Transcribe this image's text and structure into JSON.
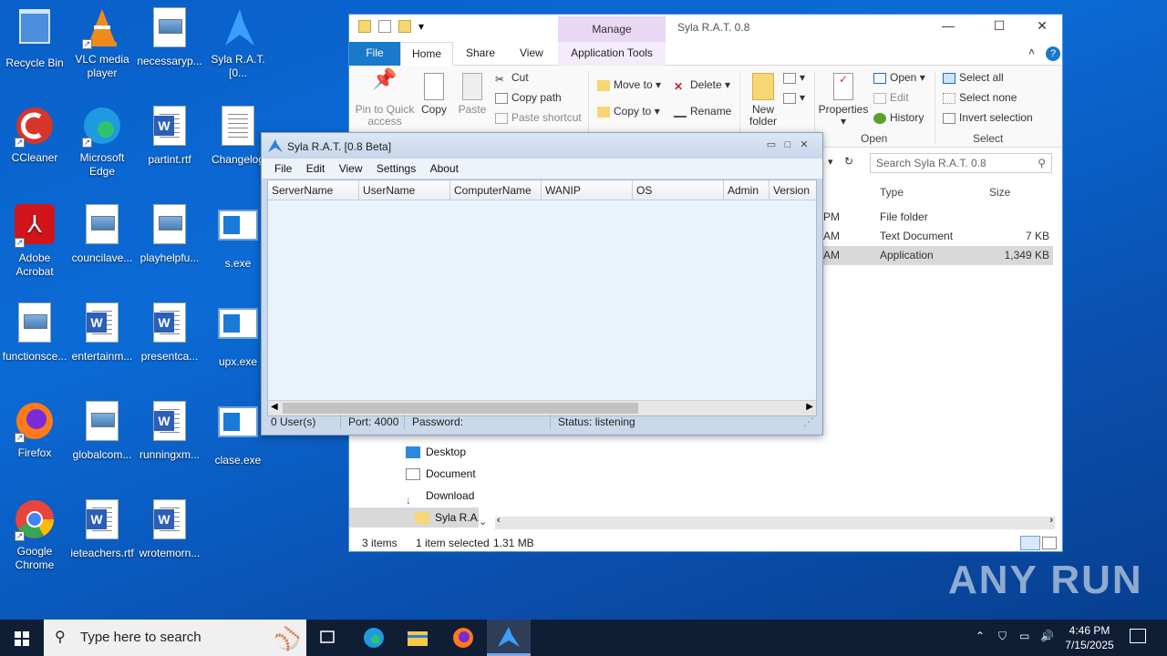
{
  "desktop": {
    "icons": [
      {
        "label": "Recycle Bin",
        "icon": "recycle-bin-icon"
      },
      {
        "label": "VLC media player",
        "icon": "vlc-icon"
      },
      {
        "label": "necessaryp...",
        "icon": "image-file-icon"
      },
      {
        "label": "Syla R.A.T.[0...",
        "icon": "syla-rat-icon"
      },
      {
        "label": "CCleaner",
        "icon": "ccleaner-icon"
      },
      {
        "label": "Microsoft Edge",
        "icon": "edge-icon"
      },
      {
        "label": "partint.rtf",
        "icon": "word-doc-icon"
      },
      {
        "label": "Changelog",
        "icon": "text-file-icon"
      },
      {
        "label": "Adobe Acrobat",
        "icon": "acrobat-icon"
      },
      {
        "label": "councilave...",
        "icon": "image-file-icon"
      },
      {
        "label": "playhelpfu...",
        "icon": "image-file-icon"
      },
      {
        "label": "s.exe",
        "icon": "exe-icon"
      },
      {
        "label": "functionsce...",
        "icon": "image-file-icon"
      },
      {
        "label": "entertainm...",
        "icon": "word-doc-icon"
      },
      {
        "label": "presentca...",
        "icon": "word-doc-icon"
      },
      {
        "label": "upx.exe",
        "icon": "exe-icon"
      },
      {
        "label": "Firefox",
        "icon": "firefox-icon"
      },
      {
        "label": "globalcom...",
        "icon": "image-file-icon"
      },
      {
        "label": "runningxm...",
        "icon": "word-doc-icon"
      },
      {
        "label": "clase.exe",
        "icon": "exe-icon"
      },
      {
        "label": "Google Chrome",
        "icon": "chrome-icon"
      },
      {
        "label": "ieteachers.rtf",
        "icon": "word-doc-icon"
      },
      {
        "label": "wrotemorn...",
        "icon": "word-doc-icon"
      }
    ]
  },
  "explorer": {
    "title": "Syla R.A.T. 0.8",
    "manage_label": "Manage",
    "tabs": [
      "File",
      "Home",
      "Share",
      "View",
      "Application Tools"
    ],
    "ribbon": {
      "pin": "Pin to Quick access",
      "copy": "Copy",
      "paste": "Paste",
      "cut": "Cut",
      "copy_path": "Copy path",
      "paste_shortcut": "Paste shortcut",
      "move_to": "Move to",
      "copy_to": "Copy to",
      "delete": "Delete",
      "rename": "Rename",
      "new_folder": "New folder",
      "properties": "Properties",
      "open": "Open",
      "edit": "Edit",
      "history": "History",
      "select_all": "Select all",
      "select_none": "Select none",
      "invert_selection": "Invert selection",
      "group_open": "Open",
      "group_select": "Select"
    },
    "search_placeholder": "Search Syla R.A.T. 0.8",
    "columns": {
      "type": "Type",
      "size": "Size"
    },
    "files": [
      {
        "time": "PM",
        "type": "File folder",
        "size": ""
      },
      {
        "time": "AM",
        "type": "Text Document",
        "size": "7 KB"
      },
      {
        "time": "AM",
        "type": "Application",
        "size": "1,349 KB"
      }
    ],
    "nav": [
      "Desktop",
      "Document",
      "Download",
      "Syla R.A."
    ],
    "status": {
      "items": "3 items",
      "selected": "1 item selected",
      "size": "1.31 MB"
    }
  },
  "rat": {
    "title": "Syla R.A.T. [0.8 Beta]",
    "menu": [
      "File",
      "Edit",
      "View",
      "Settings",
      "About"
    ],
    "columns": [
      "ServerName",
      "UserName",
      "ComputerName",
      "WANIP",
      "OS",
      "Admin",
      "Version"
    ],
    "status": {
      "users": "0 User(s)",
      "port": "Port: 4000",
      "password": "Password:",
      "state": "Status: listening"
    }
  },
  "taskbar": {
    "search_placeholder": "Type here to search",
    "time": "4:46 PM",
    "date": "7/15/2025"
  },
  "watermark": "ANY RUN"
}
